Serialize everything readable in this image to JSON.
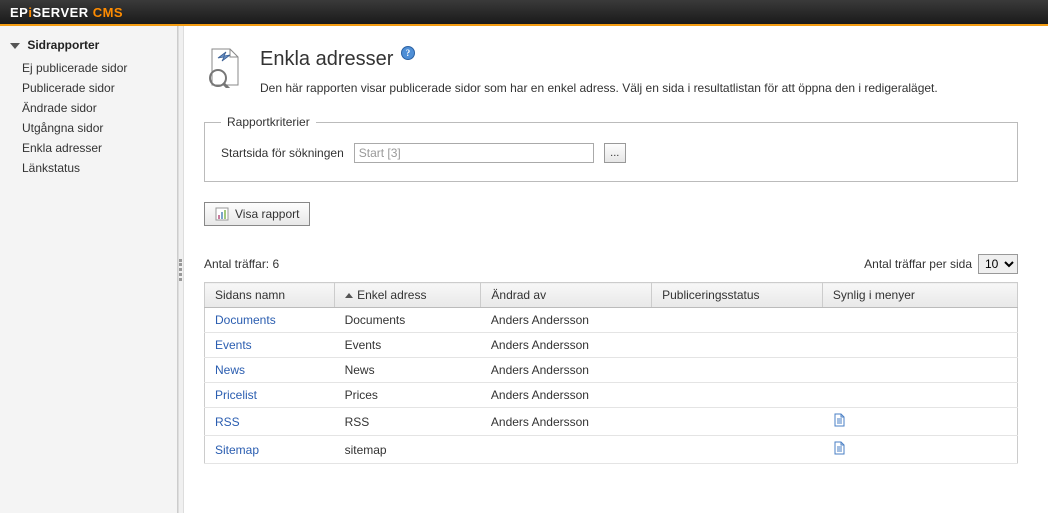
{
  "header": {
    "brand_epi": "EP",
    "brand_i": "i",
    "brand_server": "SERVER",
    "brand_cms": "CMS"
  },
  "sidebar": {
    "title": "Sidrapporter",
    "items": [
      {
        "label": "Ej publicerade sidor"
      },
      {
        "label": "Publicerade sidor"
      },
      {
        "label": "Ändrade sidor"
      },
      {
        "label": "Utgångna sidor"
      },
      {
        "label": "Enkla adresser"
      },
      {
        "label": "Länkstatus"
      }
    ]
  },
  "page": {
    "title": "Enkla adresser",
    "description": "Den här rapporten visar publicerade sidor som har en enkel adress. Välj en sida i resultatlistan för att öppna den i redigeraläget."
  },
  "criteria": {
    "legend": "Rapportkriterier",
    "start_label": "Startsida för sökningen",
    "start_value": "Start [3]",
    "browse_label": "..."
  },
  "actions": {
    "show_report": "Visa rapport"
  },
  "results": {
    "hits_label": "Antal träffar:",
    "hits_count": "6",
    "per_page_label": "Antal träffar per sida",
    "per_page_value": "10"
  },
  "columns": {
    "name": "Sidans namn",
    "address": "Enkel adress",
    "changed_by": "Ändrad av",
    "pub_status": "Publiceringsstatus",
    "visible": "Synlig i menyer"
  },
  "rows": [
    {
      "name": "Documents",
      "address": "Documents",
      "changed_by": "Anders Andersson",
      "pub_status": "",
      "visible_icon": false
    },
    {
      "name": "Events",
      "address": "Events",
      "changed_by": "Anders Andersson",
      "pub_status": "",
      "visible_icon": false
    },
    {
      "name": "News",
      "address": "News",
      "changed_by": "Anders Andersson",
      "pub_status": "",
      "visible_icon": false
    },
    {
      "name": "Pricelist",
      "address": "Prices",
      "changed_by": "Anders Andersson",
      "pub_status": "",
      "visible_icon": false
    },
    {
      "name": "RSS",
      "address": "RSS",
      "changed_by": "Anders Andersson",
      "pub_status": "",
      "visible_icon": true
    },
    {
      "name": "Sitemap",
      "address": "sitemap",
      "changed_by": "",
      "pub_status": "",
      "visible_icon": true
    }
  ]
}
